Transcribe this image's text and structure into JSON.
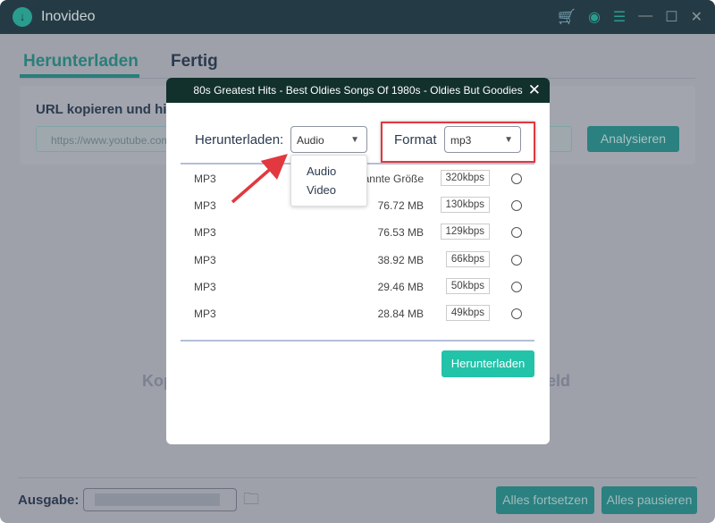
{
  "app": {
    "title": "Inovideo",
    "icons": [
      "cart-icon",
      "user-icon",
      "menu-icon",
      "minimize-icon",
      "maximize-icon",
      "close-icon"
    ]
  },
  "tabs": [
    {
      "label": "Herunterladen",
      "active": true
    },
    {
      "label": "Fertig",
      "active": false
    }
  ],
  "url_card": {
    "title": "URL kopieren und hie",
    "placeholder": "https://www.youtube.com",
    "analyze": "Analysieren"
  },
  "hint": {
    "left": "Kop",
    "right": "feld"
  },
  "bottom": {
    "output_label": "Ausgabe:",
    "resume_all": "Alles fortsetzen",
    "pause_all": "Alles pausieren"
  },
  "dialog": {
    "title": "80s Greatest Hits - Best Oldies Songs Of 1980s - Oldies But Goodies",
    "download_label": "Herunterladen:",
    "download_type": "Audio",
    "type_options": [
      "Audio",
      "Video"
    ],
    "format_label": "Format",
    "format_value": "mp3",
    "rows": [
      {
        "format": "MP3",
        "size": "Unbekannte Größe",
        "bitrate": "320kbps"
      },
      {
        "format": "MP3",
        "size": "76.72 MB",
        "bitrate": "130kbps"
      },
      {
        "format": "MP3",
        "size": "76.53 MB",
        "bitrate": "129kbps"
      },
      {
        "format": "MP3",
        "size": "38.92 MB",
        "bitrate": "66kbps"
      },
      {
        "format": "MP3",
        "size": "29.46 MB",
        "bitrate": "50kbps"
      },
      {
        "format": "MP3",
        "size": "28.84 MB",
        "bitrate": "49kbps"
      }
    ],
    "download_button": "Herunterladen"
  },
  "colors": {
    "accent": "#22c3a8",
    "titlebar": "#243b45",
    "highlight": "#e2383f"
  }
}
